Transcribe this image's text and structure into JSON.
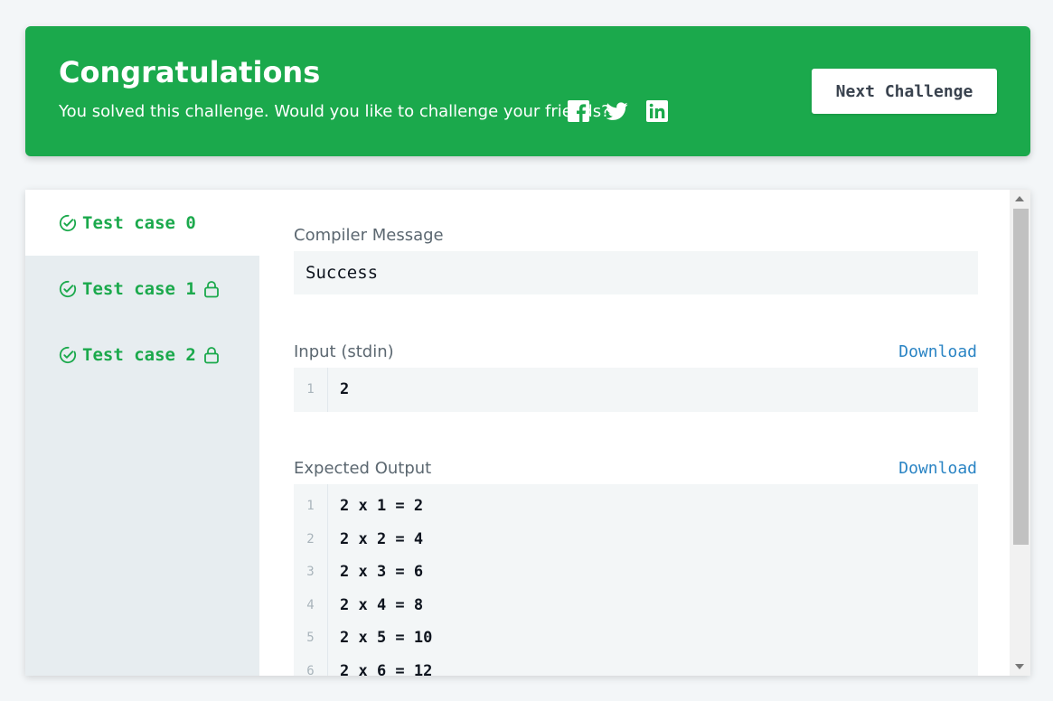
{
  "banner": {
    "title": "Congratulations",
    "subtitle": "You solved this challenge. Would you like to challenge your friends?",
    "social_icons": [
      "facebook-icon",
      "twitter-icon",
      "linkedin-icon"
    ],
    "next_button": "Next Challenge",
    "bg_color": "#1ba94c"
  },
  "tabs": [
    {
      "label": "Test case 0",
      "active": true,
      "locked": false
    },
    {
      "label": "Test case 1",
      "active": false,
      "locked": true
    },
    {
      "label": "Test case 2",
      "active": false,
      "locked": true
    }
  ],
  "compiler": {
    "label": "Compiler Message",
    "message": "Success"
  },
  "input": {
    "label": "Input (stdin)",
    "download": "Download",
    "lines": [
      {
        "n": "1",
        "text": "2"
      }
    ]
  },
  "expected": {
    "label": "Expected Output",
    "download": "Download",
    "lines": [
      {
        "n": "1",
        "text": "2 x 1 = 2"
      },
      {
        "n": "2",
        "text": "2 x 2 = 4"
      },
      {
        "n": "3",
        "text": "2 x 3 = 6"
      },
      {
        "n": "4",
        "text": "2 x 4 = 8"
      },
      {
        "n": "5",
        "text": "2 x 5 = 10"
      },
      {
        "n": "6",
        "text": "2 x 6 = 12"
      }
    ]
  }
}
